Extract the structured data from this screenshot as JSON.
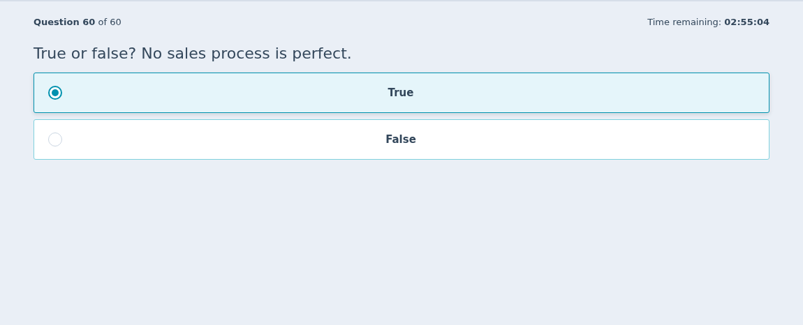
{
  "header": {
    "progress": "**Question 60** of 60",
    "timer": "Time remaining: **02:55:04**"
  },
  "question": "True or false? No sales process is perfect.",
  "options": [
    {
      "label": "True",
      "selected": true
    },
    {
      "label": "False",
      "selected": false
    }
  ]
}
